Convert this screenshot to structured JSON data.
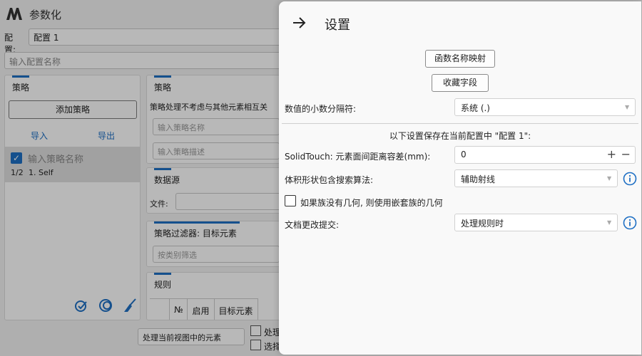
{
  "app": {
    "title": "参数化",
    "config_label": "配置:",
    "config_value": "配置 1",
    "config_name_placeholder": "输入配置名称"
  },
  "left_panel": {
    "title": "策略",
    "add_button": "添加策略",
    "import_label": "导入",
    "export_label": "导出",
    "item_placeholder": "输入策略名称",
    "item_index": "1/2",
    "item_name": "1. Self",
    "icons": [
      "check-all-icon",
      "circle-refresh-icon",
      "broom-icon"
    ]
  },
  "strategy_panel": {
    "title": "策略",
    "description": "策略处理不考虑与其他元素相互关",
    "name_placeholder": "输入策略名称",
    "desc_placeholder": "输入策略描述"
  },
  "datasource_panel": {
    "title": "数据源",
    "file_label": "文件:"
  },
  "filter_panel": {
    "title": "策略过滤器: 目标元素",
    "placeholder": "按类别筛选"
  },
  "rules_panel": {
    "title": "规则",
    "columns": [
      "№",
      "启用",
      "目标元素"
    ]
  },
  "bottom_bar": {
    "scope_select": "处理当前视图中的元素",
    "check1_label": "处理",
    "check2_label": "选择"
  },
  "settings": {
    "title": "设置",
    "function_mapping_button": "函数名称映射",
    "favorite_fields_button": "收藏字段",
    "decimal_separator_label": "数值的小数分隔符:",
    "decimal_separator_value": "系统 (.)",
    "section_header": "以下设置保存在当前配置中 \"配置 1\":",
    "solidtouch_label": "SolidTouch: 元素面间距离容差(mm):",
    "solidtouch_value": "0",
    "plus_label": "+",
    "minus_label": "−",
    "search_algo_label": "体积形状包含搜索算法:",
    "search_algo_value": "辅助射线",
    "nested_family_label": "如果族没有几何, 则使用嵌套族的几何",
    "doc_commit_label": "文档更改提交:",
    "doc_commit_value": "处理规则时"
  },
  "colors": {
    "accent": "#1e6fc4",
    "drawer_bg": "#f9f9f9"
  }
}
